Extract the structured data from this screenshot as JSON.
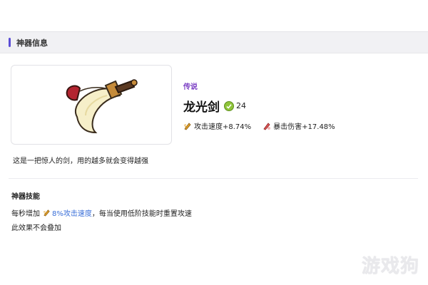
{
  "panel": {
    "title": "神器信息"
  },
  "item": {
    "rarity": "传说",
    "name": "龙光剑",
    "level": "24",
    "description": "这是一把惊人的剑，用的越多就会变得越强",
    "stats": [
      {
        "icon": "attack-speed-icon",
        "label": "攻击速度+8.74%"
      },
      {
        "icon": "crit-damage-icon",
        "label": "暴击伤害+17.48%"
      }
    ]
  },
  "skill": {
    "title": "神器技能",
    "line1_prefix": "每秒增加",
    "line1_highlight": "8%攻击速度",
    "line1_suffix": "，每当使用低阶技能时重置攻速",
    "line2": "此效果不会叠加"
  },
  "watermark": "游戏狗",
  "colors": {
    "accent": "#5b4dd6",
    "rarity": "#7b3fc4",
    "highlight": "#3a6fd8"
  }
}
